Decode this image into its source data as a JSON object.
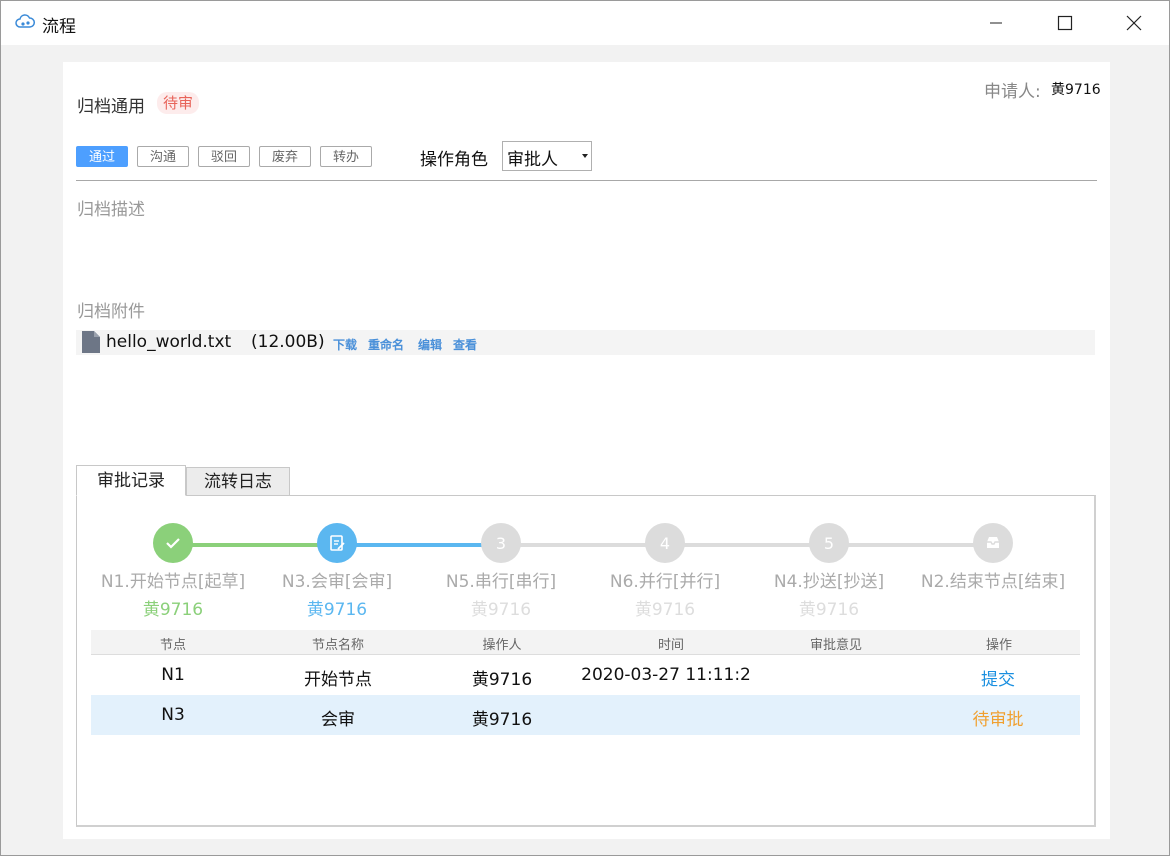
{
  "window": {
    "title": "流程",
    "icon": "cloud-flow-icon"
  },
  "header": {
    "form_title": "归档通用",
    "status": "待审",
    "applicant_label": "申请人:",
    "applicant_value": "黄9716"
  },
  "actions": [
    {
      "label": "通过",
      "primary": true
    },
    {
      "label": "沟通",
      "primary": false
    },
    {
      "label": "驳回",
      "primary": false
    },
    {
      "label": "废弃",
      "primary": false
    },
    {
      "label": "转办",
      "primary": false
    }
  ],
  "role": {
    "label": "操作角色",
    "selected": "审批人"
  },
  "description": {
    "label": "归档描述"
  },
  "attachments": {
    "label": "归档附件",
    "files": [
      {
        "name": "hello_world.txt",
        "size": "(12.00B)",
        "links": [
          "下载",
          "重命名",
          "编辑",
          "查看"
        ]
      }
    ]
  },
  "tabs": [
    {
      "label": "审批记录",
      "active": true
    },
    {
      "label": "流转日志",
      "active": false
    }
  ],
  "steps": [
    {
      "name": "N1.开始节点[起草]",
      "user": "黄9716",
      "state": "done",
      "icon": "check-icon",
      "number": ""
    },
    {
      "name": "N3.会审[会审]",
      "user": "黄9716",
      "state": "current",
      "icon": "edit-document-icon",
      "number": ""
    },
    {
      "name": "N5.串行[串行]",
      "user": "黄9716",
      "state": "pending",
      "icon": "",
      "number": "3"
    },
    {
      "name": "N6.并行[并行]",
      "user": "黄9716",
      "state": "pending",
      "icon": "",
      "number": "4"
    },
    {
      "name": "N4.抄送[抄送]",
      "user": "黄9716",
      "state": "pending",
      "icon": "",
      "number": "5"
    },
    {
      "name": "N2.结束节点[结束]",
      "user": "",
      "state": "pending",
      "icon": "inbox-icon",
      "number": ""
    }
  ],
  "record_table": {
    "columns": [
      "节点",
      "节点名称",
      "操作人",
      "时间",
      "审批意见",
      "操作"
    ],
    "rows": [
      {
        "node": "N1",
        "node_name": "开始节点",
        "operator": "黄9716",
        "time": "2020-03-27 11:11:2",
        "opinion": "",
        "action": "提交",
        "action_color": "#1a8fe0"
      },
      {
        "node": "N3",
        "node_name": "会审",
        "operator": "黄9716",
        "time": "",
        "opinion": "",
        "action": "待审批",
        "action_color": "#f0a030"
      }
    ]
  },
  "colors": {
    "primary": "#4d9fff",
    "done_green": "#8bd07a",
    "current_blue": "#5bb7f0",
    "pending_gray": "#dcdcdc"
  }
}
